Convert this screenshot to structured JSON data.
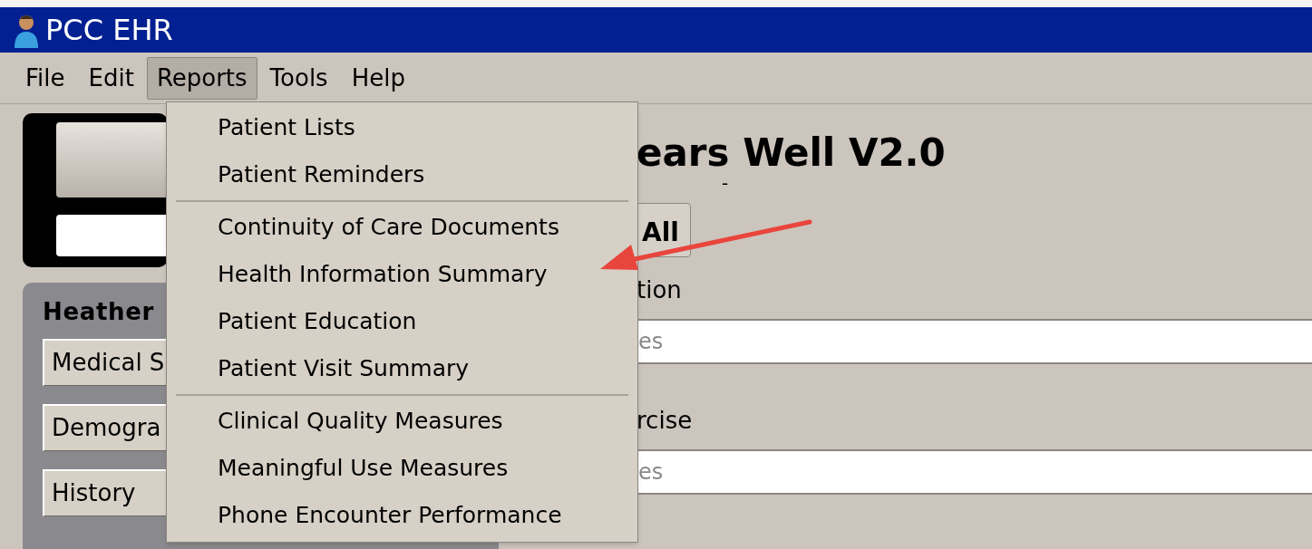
{
  "window": {
    "title": "PCC EHR"
  },
  "menu_bar": [
    {
      "label": "File",
      "selected": false
    },
    {
      "label": "Edit",
      "selected": false
    },
    {
      "label": "Reports",
      "selected": true
    },
    {
      "label": "Tools",
      "selected": false
    },
    {
      "label": "Help",
      "selected": false
    }
  ],
  "reports_menu": {
    "groups": [
      [
        "Patient Lists",
        "Patient Reminders"
      ],
      [
        "Continuity of Care Documents",
        "Health Information Summary",
        "Patient Education",
        "Patient Visit Summary"
      ],
      [
        "Clinical Quality Measures",
        "Meaningful Use Measures",
        "Phone Encounter Performance"
      ]
    ]
  },
  "patient_panel": {
    "name": "Heather",
    "buttons": [
      "Medical S",
      "Demogra",
      "History"
    ]
  },
  "main": {
    "title": "ears Well V2.0",
    "subtitle": "-",
    "button": "All",
    "sections": [
      {
        "label": "tion",
        "placeholder": "es"
      },
      {
        "label": "rcise",
        "placeholder": "es"
      }
    ]
  }
}
